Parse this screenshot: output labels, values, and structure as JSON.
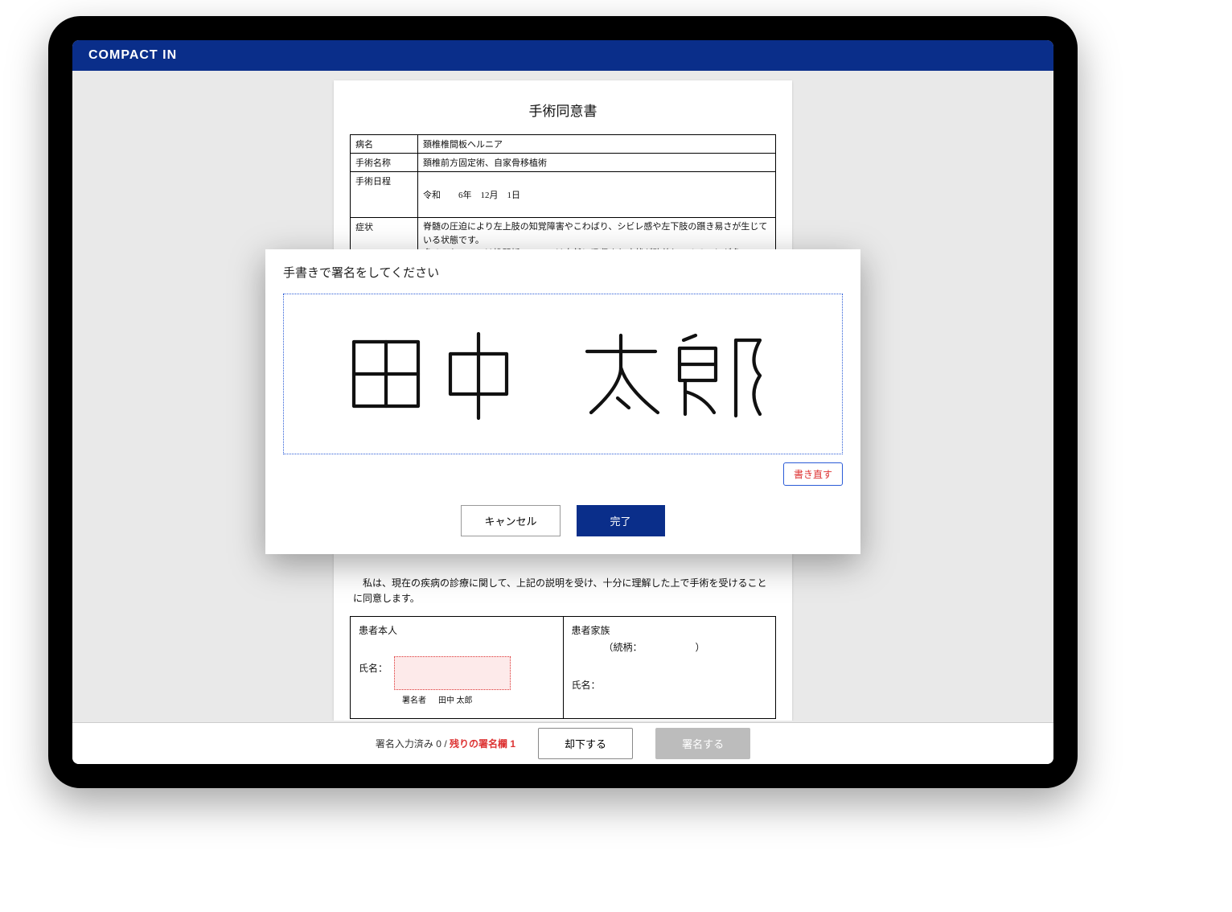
{
  "header": {
    "brand": "COMPACT IN"
  },
  "document": {
    "title": "手術同意書",
    "rows": {
      "disease_label": "病名",
      "disease_value": "頚椎椎間板ヘルニア",
      "surgery_label": "手術名称",
      "surgery_value": "頚椎前方固定術、自家骨移植術",
      "date_label": "手術日程",
      "date_value": "令和　　6年　12月　1日",
      "symptom_label": "症状",
      "symptom_value": "脊髄の圧迫により左上肢の知覚障害やこわばり、シビレ感や左下肢の躓き易さが生じている状態です。\n多くのケースでは椎間板ヘルニアは自然に吸収され症状が改善してくることが多いのです"
    },
    "consent_text": "　私は、現在の疾病の診療に関して、上記の説明を受け、十分に理解した上で手術を受けることに同意します。",
    "sig_patient": {
      "heading": "患者本人",
      "name_label": "氏名：",
      "caption_prefix": "署名者",
      "caption_name": "田中 太郎"
    },
    "sig_family": {
      "heading": "患者家族",
      "relation_label": "（続柄：　　　　　　）",
      "name_label": "氏名："
    }
  },
  "footer": {
    "status_done_label": "署名入力済み",
    "status_done_count": "0",
    "status_sep": "/",
    "status_remain_label": "残りの署名欄",
    "status_remain_count": "1",
    "reject": "却下する",
    "sign": "署名する"
  },
  "modal": {
    "title": "手書きで署名をしてください",
    "handwriting_text": "田中　太郎",
    "clear": "書き直す",
    "cancel": "キャンセル",
    "done": "完了"
  }
}
